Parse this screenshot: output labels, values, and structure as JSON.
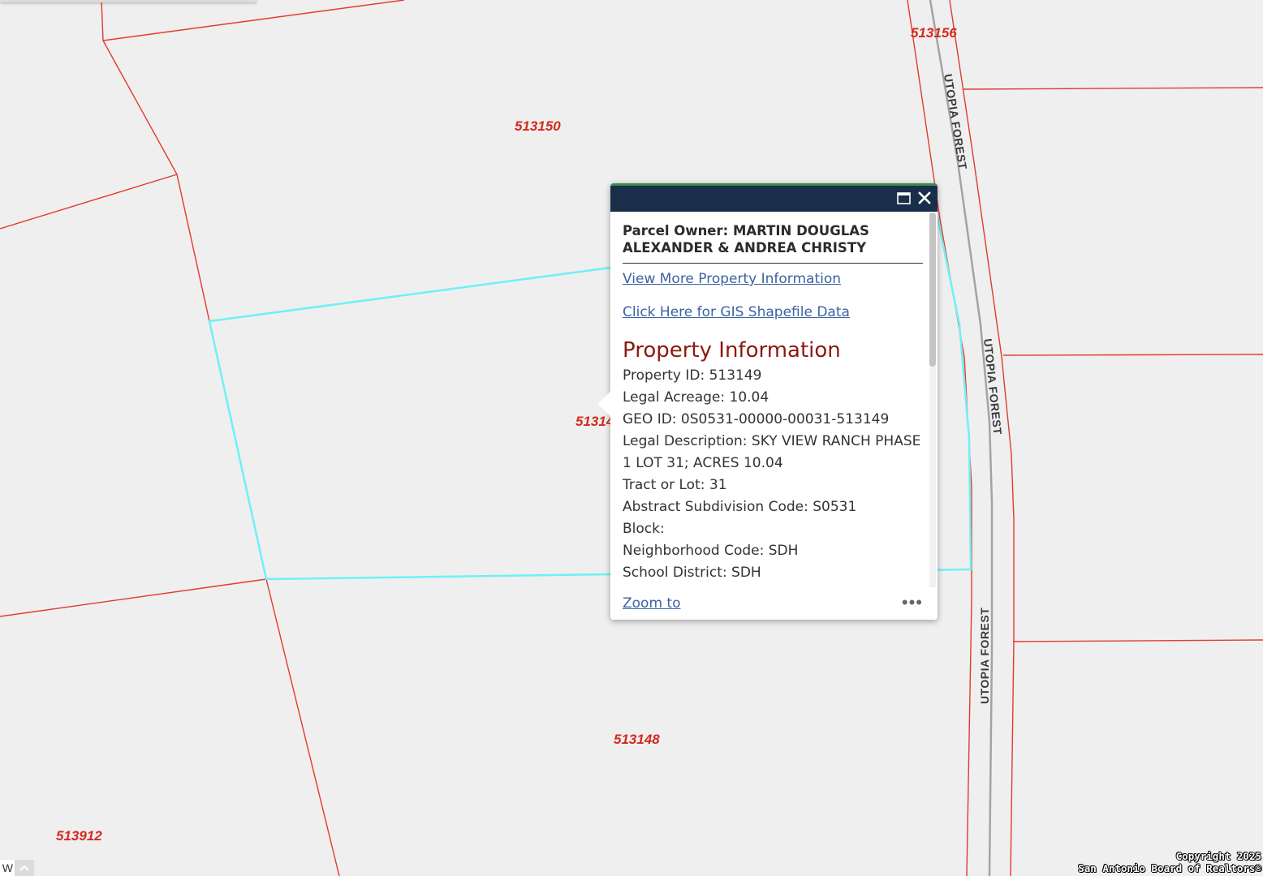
{
  "map": {
    "parcel_labels": [
      "513156",
      "513150",
      "51314",
      "513148",
      "513912"
    ],
    "road_labels": [
      "UTOPIA FOREST",
      "UTOPIA FOREST",
      "UTOPIA FOREST"
    ],
    "colors": {
      "background": "#efefef",
      "parcel_line": "#e23b2b",
      "selected_parcel": "#6ff0f7",
      "road_centerline": "#a3a3a3",
      "parcel_label": "#d42a1e"
    }
  },
  "popup": {
    "owner_title": "Parcel Owner: MARTIN DOUGLAS ALEXANDER & ANDREA CHRISTY",
    "links": {
      "view_more": "View More Property Information",
      "gis_shapefile": "Click Here for GIS Shapefile Data"
    },
    "section_title": "Property Information",
    "fields": [
      "Property ID: 513149",
      "Legal Acreage: 10.04",
      "GEO ID: 0S0531-00000-00031-513149",
      "Legal Description: SKY VIEW RANCH PHASE 1 LOT 31; ACRES 10.04",
      "Tract or Lot: 31",
      "Abstract Subdivision Code: S0531",
      "Block:",
      "Neighborhood Code: SDH",
      "School District: SDH"
    ],
    "footer": {
      "zoom_label": "Zoom to",
      "more_icon": "ellipsis-icon"
    },
    "header_icons": [
      "maximize-icon",
      "close-icon"
    ],
    "colors": {
      "header": "#192e48",
      "link": "#3a63a2",
      "section_title": "#8b1a10"
    }
  },
  "copyright": [
    "Copyright 2025",
    "San Antonio Board of Realtors®"
  ],
  "corner_controls": {
    "left_label": "W",
    "up_icon": "chevron-up-icon"
  }
}
